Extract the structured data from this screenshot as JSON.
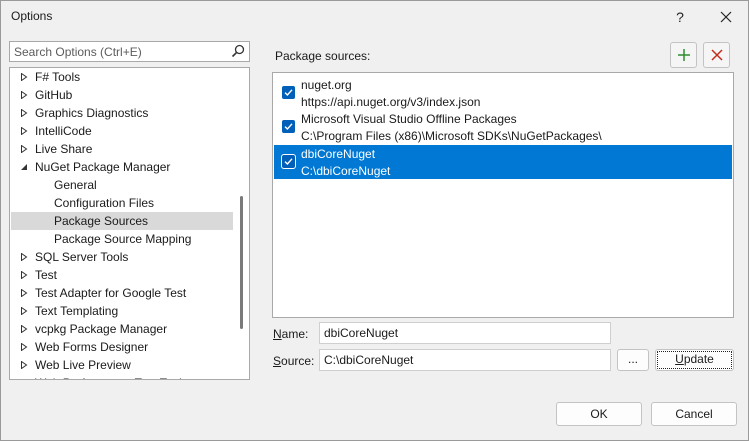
{
  "window": {
    "title": "Options",
    "help_label": "?",
    "close_label": "✕"
  },
  "search": {
    "placeholder": "Search Options (Ctrl+E)"
  },
  "tree": {
    "items": [
      {
        "label": "F# Tools",
        "level": 0,
        "arrow": "collapsed"
      },
      {
        "label": "GitHub",
        "level": 0,
        "arrow": "collapsed"
      },
      {
        "label": "Graphics Diagnostics",
        "level": 0,
        "arrow": "collapsed"
      },
      {
        "label": "IntelliCode",
        "level": 0,
        "arrow": "collapsed"
      },
      {
        "label": "Live Share",
        "level": 0,
        "arrow": "collapsed"
      },
      {
        "label": "NuGet Package Manager",
        "level": 0,
        "arrow": "expanded"
      },
      {
        "label": "General",
        "level": 1,
        "arrow": "none"
      },
      {
        "label": "Configuration Files",
        "level": 1,
        "arrow": "none"
      },
      {
        "label": "Package Sources",
        "level": 1,
        "arrow": "none",
        "selected": true
      },
      {
        "label": "Package Source Mapping",
        "level": 1,
        "arrow": "none"
      },
      {
        "label": "SQL Server Tools",
        "level": 0,
        "arrow": "collapsed"
      },
      {
        "label": "Test",
        "level": 0,
        "arrow": "collapsed"
      },
      {
        "label": "Test Adapter for Google Test",
        "level": 0,
        "arrow": "collapsed"
      },
      {
        "label": "Text Templating",
        "level": 0,
        "arrow": "collapsed"
      },
      {
        "label": "vcpkg Package Manager",
        "level": 0,
        "arrow": "collapsed"
      },
      {
        "label": "Web Forms Designer",
        "level": 0,
        "arrow": "collapsed"
      },
      {
        "label": "Web Live Preview",
        "level": 0,
        "arrow": "collapsed"
      },
      {
        "label": "Web Performance Test Tools",
        "level": 0,
        "arrow": "collapsed"
      }
    ]
  },
  "package_sources": {
    "label": "Package sources:",
    "items": [
      {
        "name": "nuget.org",
        "url": "https://api.nuget.org/v3/index.json",
        "checked": true,
        "selected": false
      },
      {
        "name": "Microsoft Visual Studio Offline Packages",
        "url": "C:\\Program Files (x86)\\Microsoft SDKs\\NuGetPackages\\",
        "checked": true,
        "selected": false
      },
      {
        "name": "dbiCoreNuget",
        "url": "C:\\dbiCoreNuget",
        "checked": true,
        "selected": true
      }
    ]
  },
  "form": {
    "name_label_prefix": "N",
    "name_label_rest": "ame:",
    "name_value": "dbiCoreNuget",
    "source_label_prefix": "S",
    "source_label_rest": "ource:",
    "source_value": "C:\\dbiCoreNuget",
    "browse_label": "...",
    "update_label_prefix": "U",
    "update_label_rest": "pdate"
  },
  "buttons": {
    "ok": "OK",
    "cancel": "Cancel"
  },
  "colors": {
    "accent": "#0078d4",
    "add_icon": "#2e8b2e",
    "remove_icon": "#c42b1c"
  }
}
